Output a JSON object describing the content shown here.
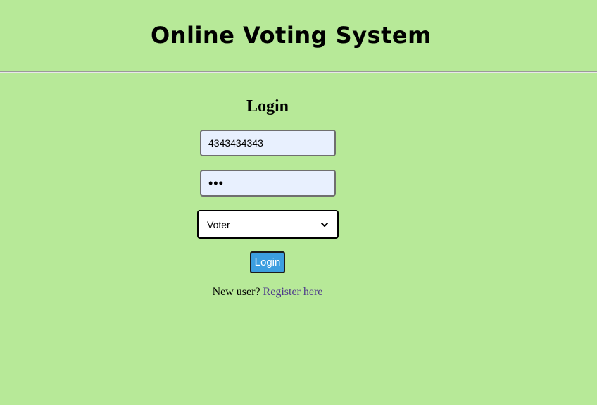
{
  "header": {
    "title": "Online Voting System"
  },
  "login": {
    "heading": "Login",
    "id_field": {
      "value": "4343434343"
    },
    "password_field": {
      "value": "•••"
    },
    "role_select": {
      "selected": "Voter"
    },
    "submit_label": "Login",
    "register_prompt": "New user?",
    "register_link": "Register here"
  },
  "colors": {
    "background": "#b7e998",
    "button": "#3c9ee0",
    "link": "#4e3a8a",
    "autofill_field": "#e8f0fe"
  },
  "icons": {
    "select_arrow": "chevron-down-icon"
  }
}
